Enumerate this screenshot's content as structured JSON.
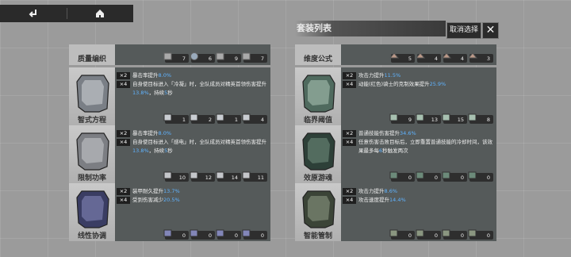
{
  "topbar": {
    "back_icon": "return-arrow-icon",
    "home_icon": "home-icon"
  },
  "list_title": "套装列表",
  "cancel_label": "取消选择",
  "close_label": "✕",
  "top_left_partial": {
    "name": "质量编织",
    "counts": [
      "7",
      "6",
      "9",
      "7"
    ]
  },
  "top_right_partial": {
    "name": "维度公式",
    "counts": [
      "5",
      "4",
      "4",
      "3"
    ]
  },
  "cards": [
    {
      "name": "智式方程",
      "lines": [
        {
          "badge": "×2",
          "pre": "暴击率提升",
          "hl": "8.0%",
          "post": ""
        },
        {
          "badge": "×4",
          "pre": "自身使目标进入「冷凝」时，全队成员对精英首领伤害提升",
          "hl": "13.8%",
          "post": "，持续",
          "hl2": "5",
          "post2": "秒"
        }
      ],
      "counts": [
        "1",
        "2",
        "1",
        "4"
      ]
    },
    {
      "name": "临界阈值",
      "lines": [
        {
          "badge": "×2",
          "pre": "攻击力提升",
          "hl": "11.5%",
          "post": ""
        },
        {
          "badge": "×4",
          "pre": "动能(红色)骑士的克制效果提升",
          "hl": "25.9%",
          "post": ""
        }
      ],
      "counts": [
        "9",
        "13",
        "15",
        "8"
      ]
    },
    {
      "name": "限制功率",
      "lines": [
        {
          "badge": "×2",
          "pre": "暴击率提升",
          "hl": "8.0%",
          "post": ""
        },
        {
          "badge": "×4",
          "pre": "自身使目标进入「感电」时，全队成员对精英首领伤害提升",
          "hl": "13.8%",
          "post": "，持续",
          "hl2": "5",
          "post2": "秒"
        }
      ],
      "counts": [
        "10",
        "12",
        "14",
        "11"
      ]
    },
    {
      "name": "效原游魂",
      "lines": [
        {
          "badge": "×2",
          "pre": "普通技能伤害提升",
          "hl": "34.6%",
          "post": ""
        },
        {
          "badge": "×4",
          "pre": "任意伤害击败目标后，立即重置普通技能的冷却时间，该效果最多每",
          "hl": "6",
          "post": "秒触发两次"
        }
      ],
      "counts": [
        "0",
        "0",
        "0",
        "0"
      ]
    },
    {
      "name": "线性协调",
      "lines": [
        {
          "badge": "×2",
          "pre": "装甲耐久提升",
          "hl": "13.7%",
          "post": ""
        },
        {
          "badge": "×4",
          "pre": "受到伤害减少",
          "hl": "20.5%",
          "post": ""
        }
      ],
      "counts": [
        "0",
        "0",
        "0",
        "0"
      ]
    },
    {
      "name": "智能管制",
      "lines": [
        {
          "badge": "×2",
          "pre": "攻击力提升",
          "hl": "8.6%",
          "post": ""
        },
        {
          "badge": "×4",
          "pre": "攻击速度提升",
          "hl": "14.4%",
          "post": ""
        }
      ],
      "counts": [
        "0",
        "0",
        "0",
        "0"
      ]
    }
  ],
  "colors": {
    "highlight": "#5fb3ff",
    "card_bg": "#555a5a",
    "badge_bg": "#1f1f1f"
  }
}
